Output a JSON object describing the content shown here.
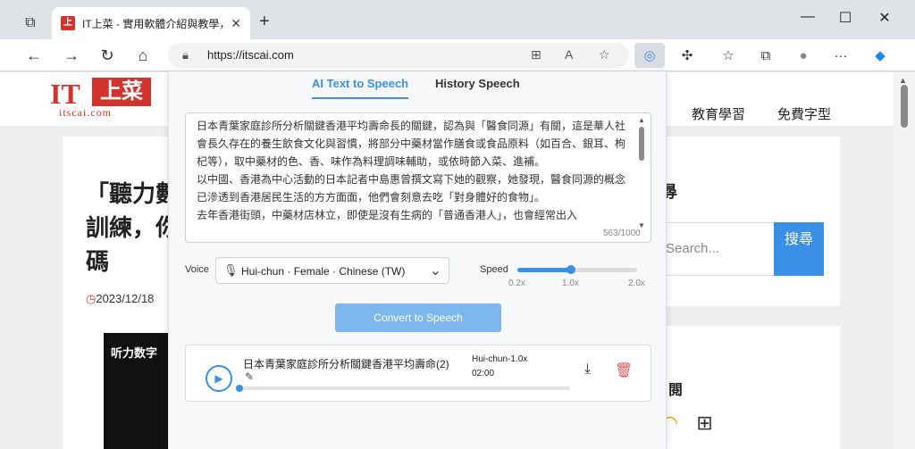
{
  "browser": {
    "tab_title": "IT上菜 - 實用軟體介紹與教學，零",
    "tab_favicon": "上",
    "new_tab": "+",
    "url": "https://itscai.com"
  },
  "site": {
    "logo_it": "IT",
    "logo_cn": "上菜",
    "logo_sub": "itscai.com",
    "nav": [
      "教育學習",
      "免費字型"
    ],
    "headline_lines": [
      "「聽力數",
      "訓練，你",
      "碼"
    ],
    "date": "2023/12/18",
    "video_text": "听力数字",
    "side_title": "尋",
    "search_placeholder": "Search...",
    "search_button": "搜尋",
    "side_title2": "閱"
  },
  "popup": {
    "tabs": [
      "AI Text to Speech",
      "History Speech"
    ],
    "text": "日本青葉家庭診所分析關鍵香港平均壽命長的關鍵，認為與「醫食同源」有關，這是華人社會長久存在的養生飲食文化與習慣，將部分中藥材當作膳食或食品原料（如百合、銀耳、枸杞等），取中藥材的色、香、味作為料理調味輔助，或依時節入菜、進補。\n以中國、香港為中心活動的日本記者中島惠曾撰文寫下她的觀察，她發現，醫食同源的概念已滲透到香港居民生活的方方面面，他們會刻意去吃「對身體好的食物」。\n去年香港街頭，中藥材店林立，即使是沒有生病的「普通香港人」，也會經常出入",
    "char_count": "563/1000",
    "voice_label": "Voice",
    "voice_value": "Hui-chun · Female · Chinese (TW)",
    "speed_label": "Speed",
    "speed_ticks": [
      "0.2x",
      "1.0x",
      "2.0x"
    ],
    "speed_value": 1.0,
    "speed_min": 0.2,
    "speed_max": 2.0,
    "convert_button": "Convert to Speech",
    "history": {
      "title": "日本青葉家庭診所分析關鍵香港平均壽命(2)",
      "voice": "Hui-chun-1.0x",
      "duration": "02:00"
    }
  }
}
